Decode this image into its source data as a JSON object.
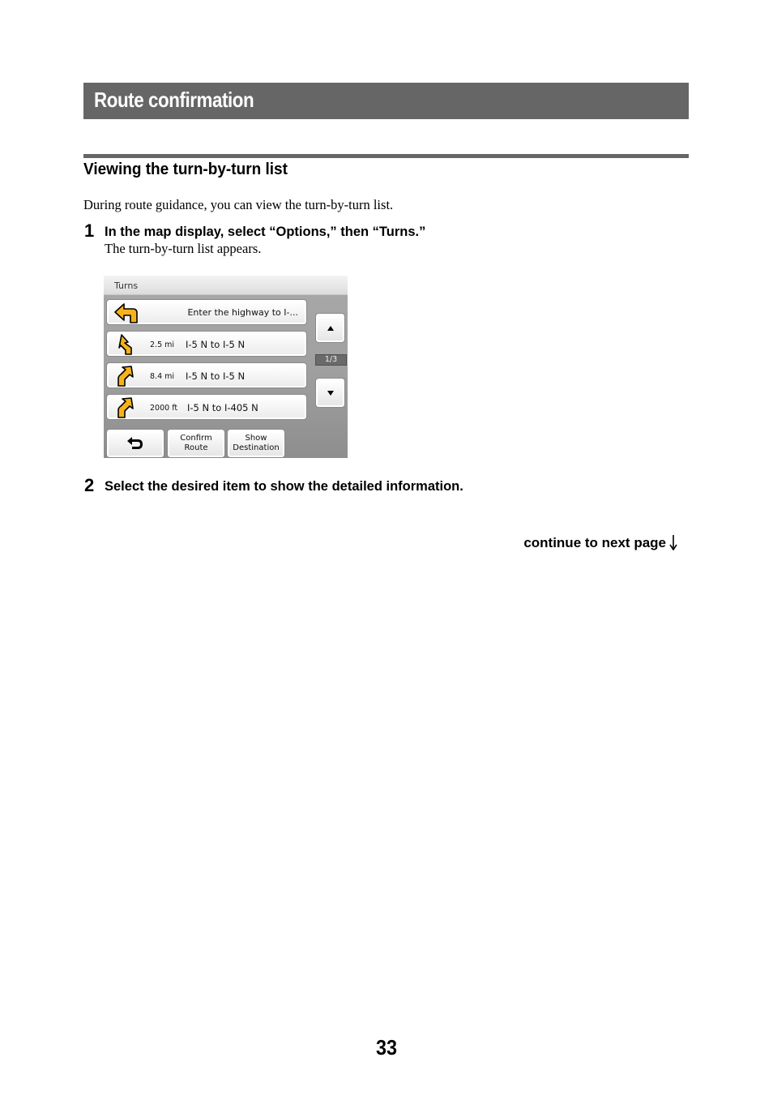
{
  "section": {
    "title": "Route confirmation"
  },
  "subsection": {
    "title": "Viewing the turn-by-turn list"
  },
  "intro": "During route guidance, you can view the turn-by-turn list.",
  "steps": [
    {
      "number": "1",
      "text": "In the map display, select “Options,” then “Turns.”",
      "subtext": "The turn-by-turn list appears."
    },
    {
      "number": "2",
      "text": "Select the desired item to show the detailed information."
    }
  ],
  "screen": {
    "header": "Turns",
    "turns": [
      {
        "icon": "turn-left-arrow-icon",
        "distance": "",
        "road": "Enter the highway to I-..."
      },
      {
        "icon": "bear-left-arrow-icon",
        "distance": "2.5 mi",
        "road": "I-5 N to I-5 N"
      },
      {
        "icon": "bear-right-arrow-icon",
        "distance": "8.4 mi",
        "road": "I-5 N to I-5 N"
      },
      {
        "icon": "bear-right-arrow-icon",
        "distance": "2000 ft",
        "road": "I-5 N to I-405 N"
      }
    ],
    "page_indicator": "1/3",
    "buttons": {
      "back_icon": "back-arrow-icon",
      "confirm_route": "Confirm Route",
      "show_destination": "Show Destination"
    },
    "colors": {
      "arrow_fill": "#f5b21a",
      "arrow_outline": "#000000"
    }
  },
  "continue_label": "continue to next page",
  "page_number": "33"
}
